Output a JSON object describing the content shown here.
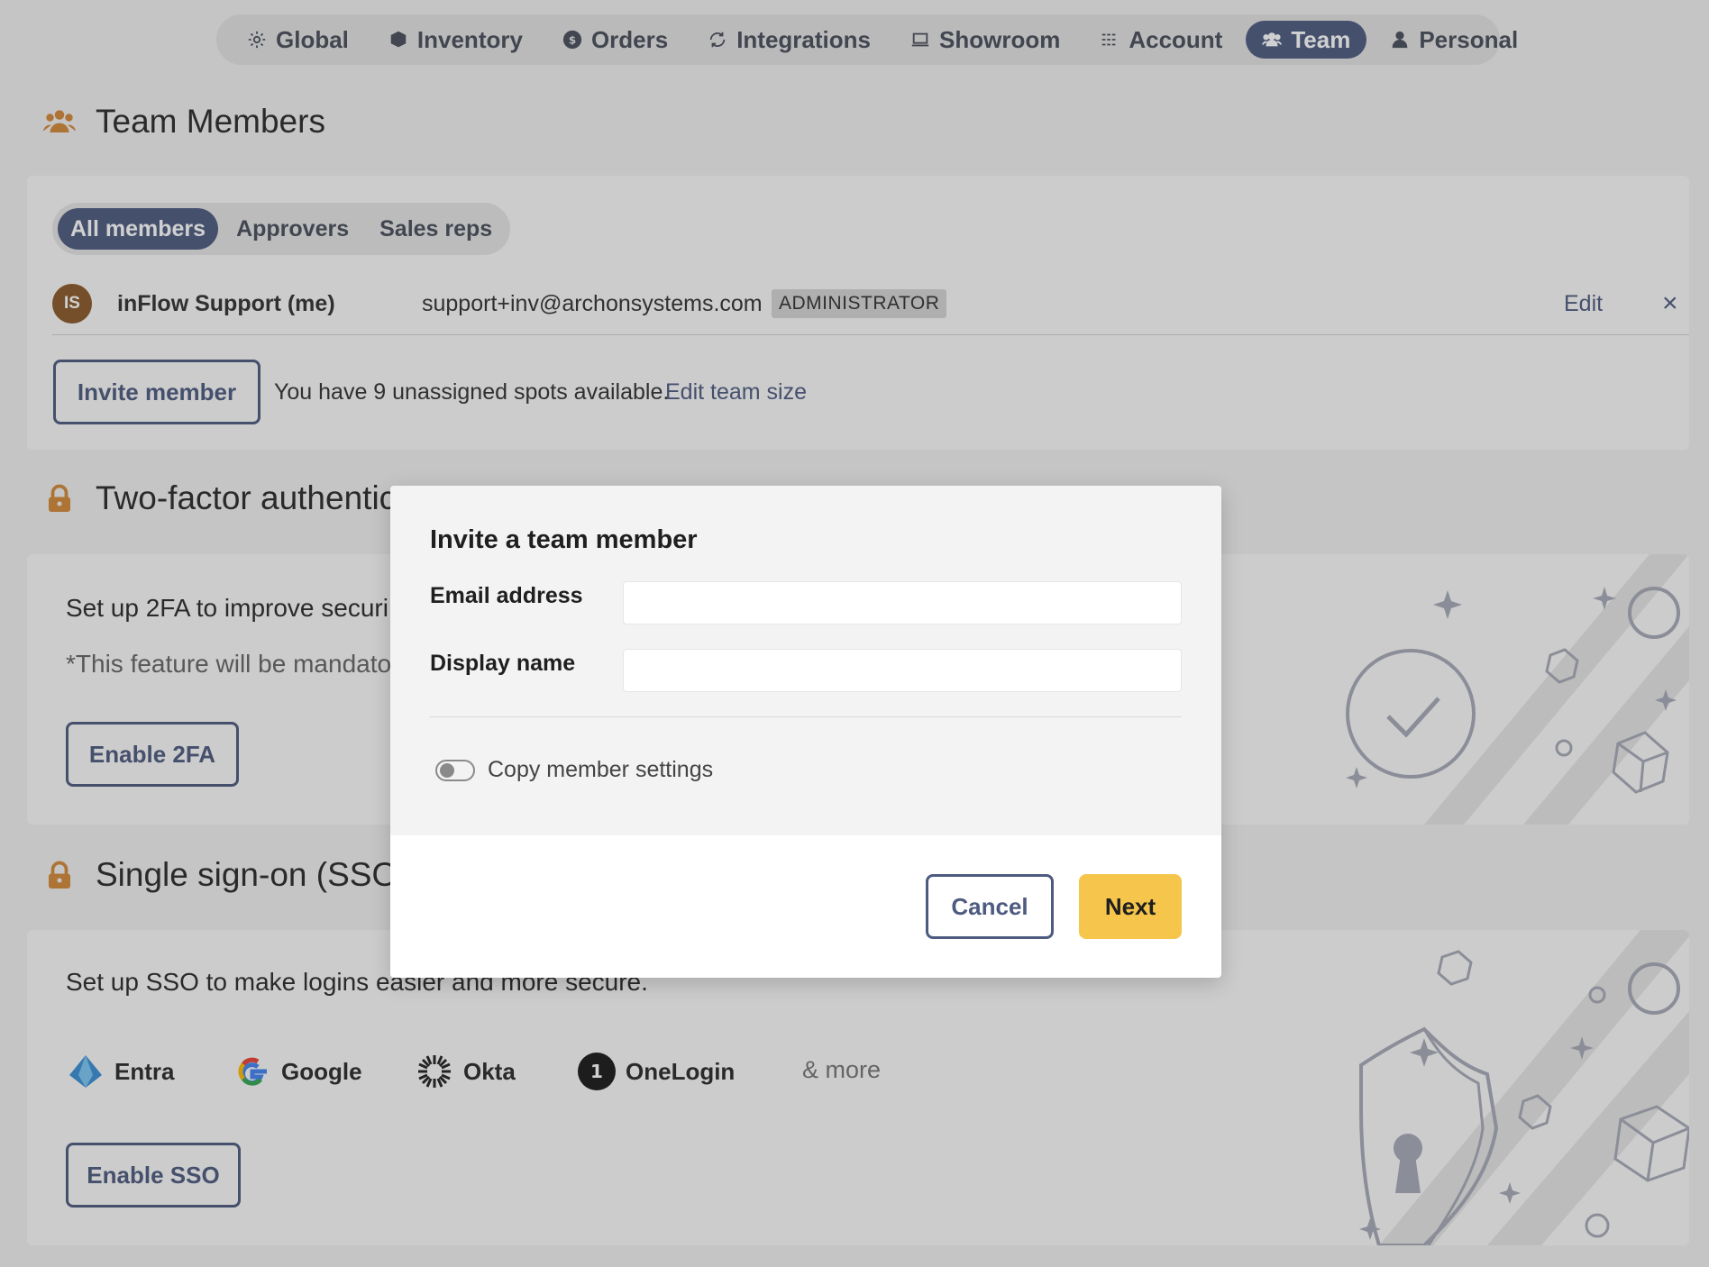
{
  "nav": {
    "items": [
      {
        "label": "Global",
        "icon": "gear-icon"
      },
      {
        "label": "Inventory",
        "icon": "box-icon"
      },
      {
        "label": "Orders",
        "icon": "dollar-icon"
      },
      {
        "label": "Integrations",
        "icon": "sync-icon"
      },
      {
        "label": "Showroom",
        "icon": "laptop-icon"
      },
      {
        "label": "Account",
        "icon": "sliders-icon"
      },
      {
        "label": "Team",
        "icon": "team-icon",
        "active": true
      },
      {
        "label": "Personal",
        "icon": "person-icon"
      }
    ]
  },
  "team": {
    "title": "Team Members",
    "filters": [
      "All members",
      "Approvers",
      "Sales reps"
    ],
    "active_filter": "All members",
    "members": [
      {
        "initials": "IS",
        "name": "inFlow Support (me)",
        "email": "support+inv@archonsystems.com",
        "role": "ADMINISTRATOR",
        "edit_label": "Edit",
        "remove_label": "×"
      }
    ],
    "invite_label": "Invite member",
    "spots_text": "You have 9 unassigned spots available.",
    "team_size_link": "Edit team size"
  },
  "twofa": {
    "title": "Two-factor authentic",
    "description": "Set up 2FA to improve securi",
    "note": "*This feature will be mandato",
    "button": "Enable 2FA"
  },
  "sso": {
    "title": "Single sign-on (SSO)",
    "description": "Set up SSO to make logins easier and more secure.",
    "providers": [
      "Entra",
      "Google",
      "Okta",
      "OneLogin"
    ],
    "more": "& more",
    "button": "Enable SSO"
  },
  "modal": {
    "title": "Invite a team member",
    "email_label": "Email address",
    "email_value": "",
    "name_label": "Display name",
    "name_value": "",
    "toggle_label": "Copy member settings",
    "toggle_on": false,
    "cancel": "Cancel",
    "next": "Next"
  },
  "colors": {
    "accent": "#4e5b80",
    "primary_button": "#f6c54b",
    "avatar": "#8a5a2b",
    "section_icon": "#d4893a"
  }
}
